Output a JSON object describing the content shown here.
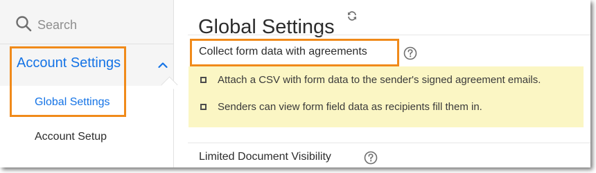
{
  "sidebar": {
    "search": {
      "placeholder": "Search",
      "icon": "search-icon"
    },
    "group": {
      "label": "Account Settings",
      "expanded": true
    },
    "items": [
      {
        "label": "Global Settings",
        "active": true
      },
      {
        "label": "Account Setup",
        "active": false
      }
    ]
  },
  "main": {
    "title": "Global Settings",
    "sections": [
      {
        "label": "Collect form data with agreements",
        "options": [
          {
            "label": "Attach a CSV with form data to the sender's signed agreement emails.",
            "checked": false
          },
          {
            "label": "Senders can view form field data as recipients fill them in.",
            "checked": false
          }
        ]
      },
      {
        "label": "Limited Document Visibility"
      }
    ]
  },
  "colors": {
    "accent": "#1473e6",
    "highlight_border": "#f08a1a",
    "highlight_fill": "#fbf6c4"
  }
}
